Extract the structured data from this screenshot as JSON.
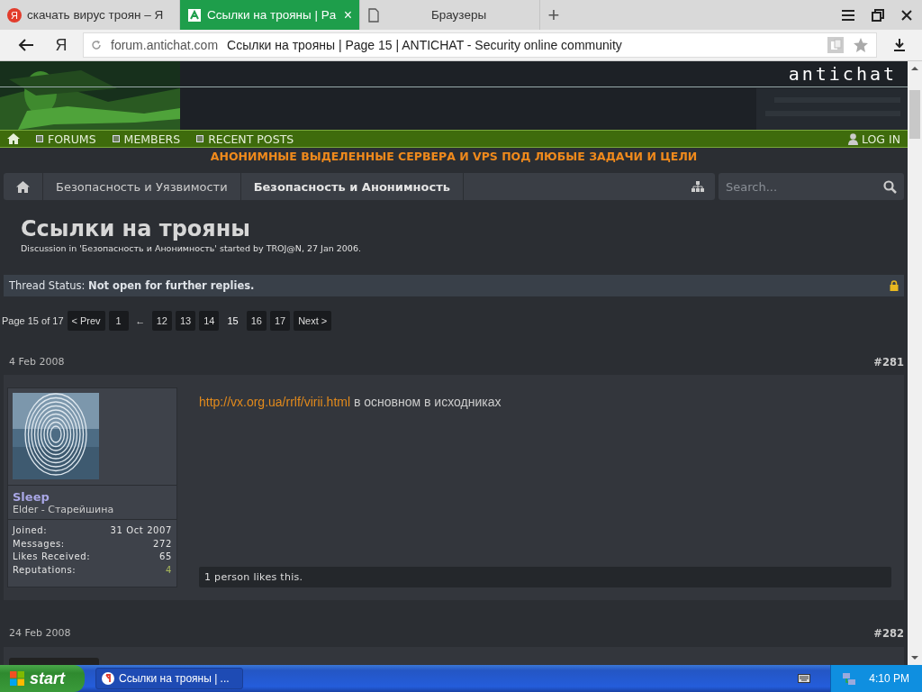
{
  "browser": {
    "tabs": [
      {
        "title": "скачать вирус троян – Я",
        "kind": "search",
        "icon_text": "Я",
        "selected": false
      },
      {
        "title": "Ссылки на трояны | Pa",
        "kind": "site",
        "selected": true,
        "close": "×"
      },
      {
        "title": "Браузеры",
        "kind": "blank",
        "selected": false
      }
    ],
    "new_tab": "+",
    "home_button": "Я",
    "address": {
      "domain": "forum.antichat.com",
      "page_title": "Ссылки на трояны | Page 15 | ANTICHAT - Security online community"
    }
  },
  "forum": {
    "logo": "antichat",
    "nav": {
      "items": [
        {
          "label": "FORUMS"
        },
        {
          "label": "MEMBERS"
        },
        {
          "label": "RECENT POSTS"
        }
      ],
      "login": "LOG IN"
    },
    "banner": "АНОНИМНЫЕ ВЫДЕЛЕННЫЕ СЕРВЕРА И VPS ПОД ЛЮБЫЕ ЗАДАЧИ И ЦЕЛИ",
    "breadcrumbs": [
      {
        "label": "Безопасность и Уязвимости",
        "selected": false
      },
      {
        "label": "Безопасность и Анонимность",
        "selected": true
      }
    ],
    "search": {
      "placeholder": "Search..."
    },
    "thread": {
      "title": "Ссылки на трояны",
      "meta": "Discussion in 'Безопасность и Анонимность' started by TROJ@N, 27 Jan 2006."
    },
    "status": "Thread Status: **Not open for further replies.**",
    "pagination": {
      "summary": "Page 15 of 17",
      "items": [
        {
          "label": "< Prev",
          "kind": "link",
          "selected": false
        },
        {
          "label": "1",
          "kind": "link",
          "selected": false
        },
        {
          "label": "←",
          "kind": "gap"
        },
        {
          "label": "12",
          "kind": "link",
          "selected": false
        },
        {
          "label": "13",
          "kind": "link",
          "selected": false
        },
        {
          "label": "14",
          "kind": "link",
          "selected": false
        },
        {
          "label": "15",
          "kind": "link",
          "selected": true
        },
        {
          "label": "16",
          "kind": "link",
          "selected": false
        },
        {
          "label": "17",
          "kind": "link",
          "selected": false
        },
        {
          "label": "Next >",
          "kind": "link",
          "selected": false
        }
      ]
    },
    "posts": [
      {
        "date": "4 Feb 2008",
        "number": "#281",
        "user": {
          "name": "Sleep",
          "title": "Elder - Старейшина",
          "stats": [
            {
              "label": "Joined:",
              "value": "31 Oct 2007",
              "kind": "plain"
            },
            {
              "label": "Messages:",
              "value": "272",
              "kind": "plain"
            },
            {
              "label": "Likes Received:",
              "value": "65",
              "kind": "plain"
            },
            {
              "label": "Reputations:",
              "value": "4",
              "kind": "positive"
            }
          ]
        },
        "message": {
          "link": "http://vx.org.ua/rrlf/virii.html",
          "text": "в основном в исходниках"
        },
        "likes": "1 person likes this."
      },
      {
        "date": "24 Feb 2008",
        "number": "#282"
      }
    ]
  },
  "taskbar": {
    "start": "start",
    "tasks": [
      {
        "label": "Ссылки на трояны | ..."
      }
    ],
    "clock": "4:10 PM"
  }
}
